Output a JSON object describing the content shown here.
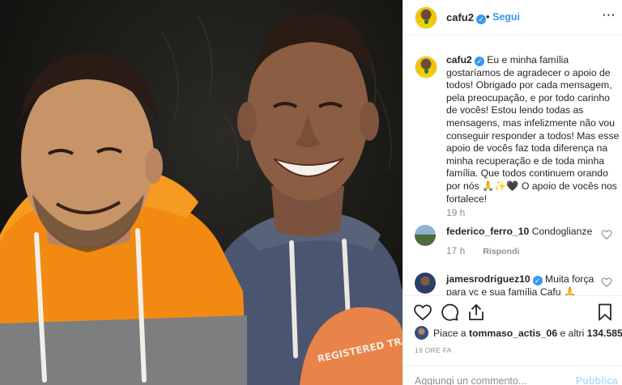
{
  "post": {
    "username": "cafu2",
    "verified": true,
    "separator": "•",
    "follow_label": "Segui",
    "more_icon": "⋯"
  },
  "caption": {
    "username": "cafu2",
    "text": "Eu e minha família gostaríamos de agradecer o apoio de todos! Obrigado por cada mensagem, pela preocupação, e por todo carinho de vocês! Estou lendo todas as mensagens, mas infelizmente não vou conseguir responder a todos! Mas esse apoio de vocês faz toda diferença na minha recuperação e de toda minha família. Que todos continuem orando por nós",
    "emoji": [
      "🙏",
      "✨",
      "🖤"
    ],
    "text_end": "O apoio de vocês nos fortalece!",
    "time": "19 h"
  },
  "comments": [
    {
      "username": "federico_ferro_10",
      "verified": false,
      "text": "Condoglianze",
      "time": "17 h",
      "reply_label": "Rispondi"
    },
    {
      "username": "jamesrodriguez10",
      "verified": true,
      "text": "Muita força para vc e sua família Cafu",
      "emoji": "🙏"
    }
  ],
  "likes": {
    "prefix": "Piace a",
    "user": "tommaso_actis_06",
    "middle": "e altri",
    "count": "134.585"
  },
  "date": "19 ORE FA",
  "add_comment": {
    "placeholder": "Aggiungi un commento...",
    "publish_label": "Pubblica"
  },
  "photo": {
    "jersey_text": "REGISTERED TRADEMARK"
  },
  "colors": {
    "accent": "#3897f0",
    "secondary_text": "#8e8e8e",
    "publish_disabled": "#b2dffc",
    "orange_hoodie": "#f28a12",
    "gray_hoodie": "#4a5570"
  }
}
